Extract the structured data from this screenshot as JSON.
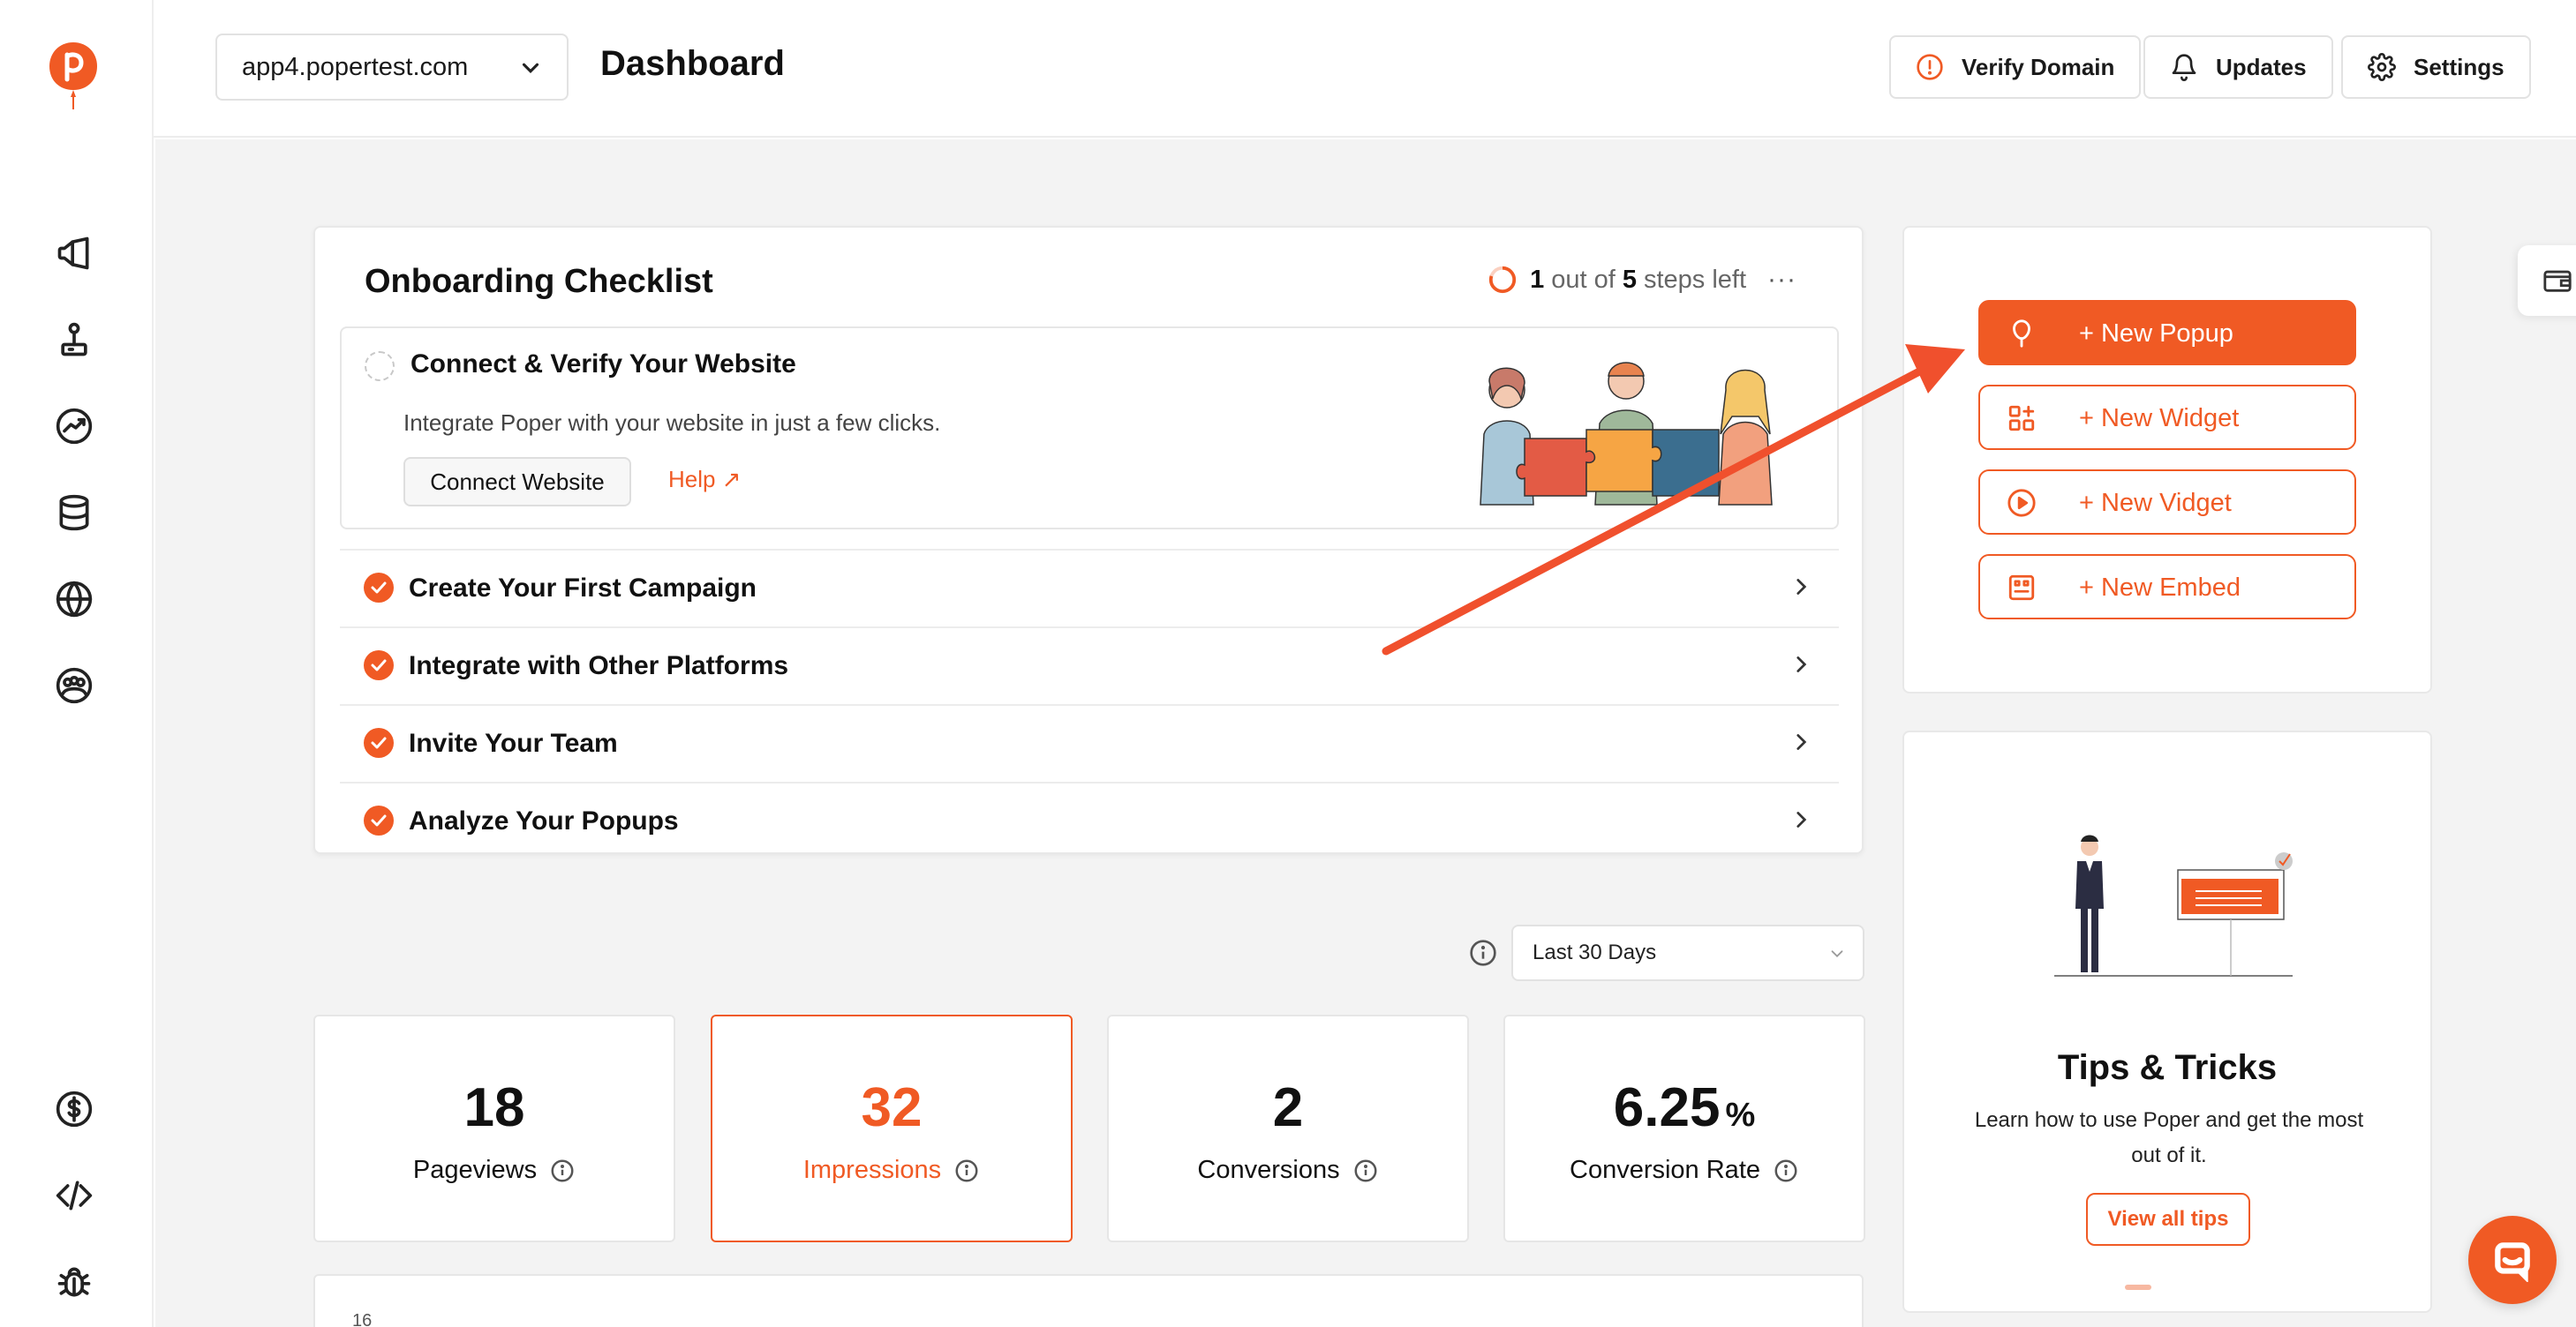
{
  "brand": {
    "accent": "#f05a24"
  },
  "header": {
    "domain": "app4.popertest.com",
    "title": "Dashboard",
    "verify_label": "Verify Domain",
    "updates_label": "Updates",
    "settings_label": "Settings"
  },
  "sidebar": {
    "items": [
      {
        "icon": "megaphone-icon"
      },
      {
        "icon": "joystick-icon"
      },
      {
        "icon": "trending-up-icon"
      },
      {
        "icon": "database-icon"
      },
      {
        "icon": "globe-icon"
      },
      {
        "icon": "community-icon"
      },
      {
        "icon": "dollar-icon"
      },
      {
        "icon": "code-icon"
      },
      {
        "icon": "bug-icon"
      }
    ]
  },
  "onboarding": {
    "title": "Onboarding Checklist",
    "progress_done": "1",
    "progress_mid": "out of",
    "progress_total": "5",
    "progress_suffix": "steps left",
    "open_step": {
      "title": "Connect & Verify Your Website",
      "description": "Integrate Poper with your website in just a few clicks.",
      "connect_label": "Connect Website",
      "help_label": "Help ↗"
    },
    "steps": [
      {
        "label": "Create Your First Campaign"
      },
      {
        "label": "Integrate with Other Platforms"
      },
      {
        "label": "Invite Your Team"
      },
      {
        "label": "Analyze Your Popups"
      }
    ]
  },
  "quick_actions": {
    "new_popup": "+ New Popup",
    "new_widget": "+ New Widget",
    "new_vidget": "+ New Vidget",
    "new_embed": "+ New Embed"
  },
  "tips": {
    "title": "Tips & Tricks",
    "description": "Learn how to use Poper and get the most out of it.",
    "button": "View all tips"
  },
  "date_range": {
    "selected": "Last 30 Days"
  },
  "stats": [
    {
      "value": "18",
      "unit": "",
      "label": "Pageviews"
    },
    {
      "value": "32",
      "unit": "",
      "label": "Impressions"
    },
    {
      "value": "2",
      "unit": "",
      "label": "Conversions"
    },
    {
      "value": "6.25",
      "unit": "%",
      "label": "Conversion Rate"
    }
  ],
  "chart": {
    "first_tick": "16"
  }
}
